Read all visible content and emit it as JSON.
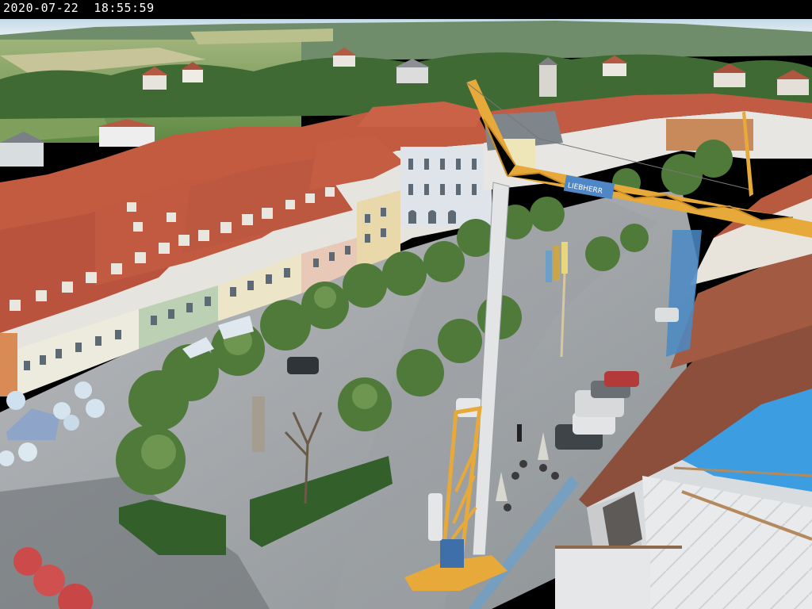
{
  "overlay": {
    "timestamp": "2020-07-22  18:55:59"
  },
  "crane": {
    "brand_text": "LIEBHERR"
  },
  "colors": {
    "sky": "#cfe0ee",
    "roof": "#c2573f",
    "facade_white": "#e9edf0",
    "tree": "#4f7a3a",
    "pavement": "#a9adb0",
    "crane_yellow": "#e6a93a",
    "tarp_blue": "#3c9ee0"
  }
}
